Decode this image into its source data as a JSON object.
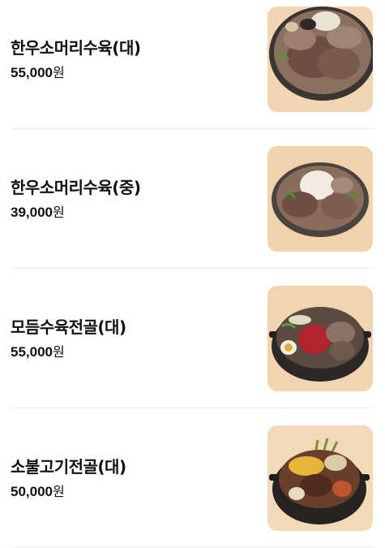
{
  "menu": {
    "items": [
      {
        "name": "한우소머리수육(대)",
        "price": "55,000",
        "unit": "원",
        "image": "beef-head-suyuk-large-photo"
      },
      {
        "name": "한우소머리수육(중)",
        "price": "39,000",
        "unit": "원",
        "image": "beef-head-suyuk-medium-photo"
      },
      {
        "name": "모듬수육전골(대)",
        "price": "55,000",
        "unit": "원",
        "image": "assorted-suyuk-hotpot-photo"
      },
      {
        "name": "소불고기전골(대)",
        "price": "50,000",
        "unit": "원",
        "image": "bulgogi-hotpot-photo"
      }
    ]
  }
}
